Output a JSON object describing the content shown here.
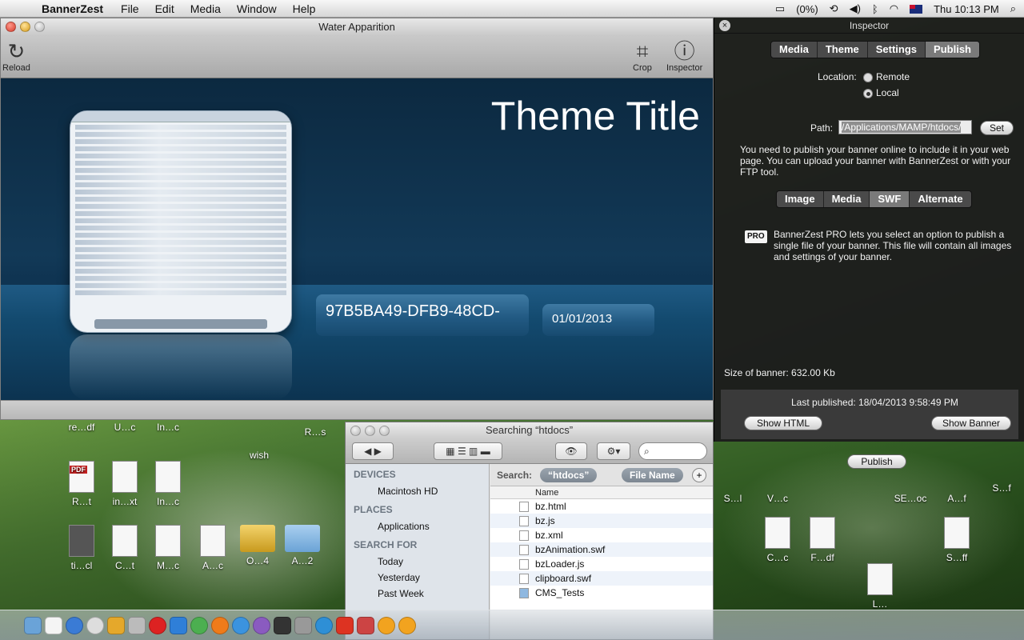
{
  "menubar": {
    "app_name": "BannerZest",
    "menus": [
      "File",
      "Edit",
      "Media",
      "Window",
      "Help"
    ],
    "battery": "(0%)",
    "clock": "Thu 10:13 PM"
  },
  "main_window": {
    "title": "Water Apparition",
    "reload_label": "Reload",
    "crop_label": "Crop",
    "inspector_label": "Inspector",
    "banner": {
      "theme_title": "Theme Title",
      "caption_id": "97B5BA49-DFB9-48CD-",
      "caption_date": "01/01/2013"
    }
  },
  "inspector": {
    "title": "Inspector",
    "tabs": [
      "Media",
      "Theme",
      "Settings",
      "Publish"
    ],
    "selected_tab": "Publish",
    "location_label": "Location:",
    "location_remote": "Remote",
    "location_local": "Local",
    "path_label": "Path:",
    "path_value": "/Applications/MAMP/htdocs/",
    "set_button": "Set",
    "info_text": "You need to publish your banner online to include it in your web page. You can upload your banner with BannerZest or with your FTP tool.",
    "format_tabs": [
      "Image",
      "Media",
      "SWF",
      "Alternate"
    ],
    "selected_format": "SWF",
    "pro_badge": "PRO",
    "pro_text": "BannerZest PRO lets you select an option to publish a single file of your banner. This file will contain all images and settings of your banner.",
    "size_text": "Size of banner: 632.00 Kb",
    "last_published": "Last published: 18/04/2013 9:58:49 PM",
    "show_html_button": "Show HTML",
    "show_banner_button": "Show Banner",
    "publish_button": "Publish"
  },
  "finder": {
    "title": "Searching “htdocs”",
    "devices_header": "DEVICES",
    "device_item": "Macintosh HD",
    "places_header": "PLACES",
    "places_item": "Applications",
    "search_for_header": "SEARCH FOR",
    "search_for_items": [
      "Today",
      "Yesterday",
      "Past Week"
    ],
    "search_label": "Search:",
    "scope_chip": "“htdocs”",
    "criteria_chip": "File Name",
    "column_name": "Name",
    "files": [
      "bz.html",
      "bz.js",
      "bz.xml",
      "bzAnimation.swf",
      "bzLoader.js",
      "clipboard.swf",
      "CMS_Tests"
    ]
  },
  "desktop_icons": {
    "left": [
      "re…df",
      "U…c",
      "In…c",
      "R…t",
      "in…xt",
      "In…c",
      "ti…cl",
      "C…t",
      "M…c",
      "A…c",
      "O…4",
      "A…2",
      "wish",
      "R…s"
    ],
    "right": [
      "S…l",
      "V…c",
      "SE…oc",
      "A…f",
      "S…f",
      "C…c",
      "F…df",
      "S…ff",
      "L…"
    ]
  },
  "colors": {
    "stage_dark": "#0c2940",
    "inspector_bg": "#1c1c1c",
    "accent_pill": "#225a83"
  }
}
